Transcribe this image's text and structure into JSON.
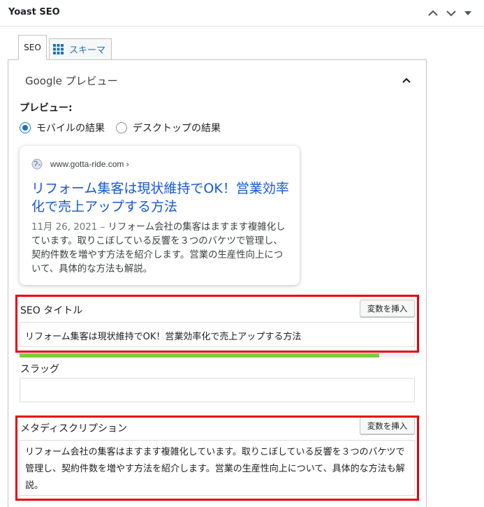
{
  "header": {
    "title": "Yoast SEO"
  },
  "tabs": [
    {
      "label": "SEO"
    },
    {
      "label": "スキーマ"
    }
  ],
  "google_preview": {
    "title": "Google プレビュー",
    "preview_label": "プレビュー:",
    "radio_mobile": "モバイルの結果",
    "radio_desktop": "デスクトップの結果",
    "selected_mode": "モバイルの結果"
  },
  "serp_card": {
    "url": "www.gotta-ride.com",
    "url_suffix": " ›",
    "title": "リフォーム集客は現状維持でOK！営業効率化で売上アップする方法",
    "date": "11月 26, 2021",
    "separator": " – ",
    "description": "リフォーム会社の集客はますます複雑化しています。取りこぼしている反響を３つのバケツで管理し、契約件数を増やす方法を紹介します。営業の生産性向上について、具体的な方法も解説。"
  },
  "seo_title": {
    "label": "SEO タイトル",
    "insert_button": "変数を挿入",
    "value": "リフォーム集客は現状維持でOK！営業効率化で売上アップする方法",
    "progress": 0.91
  },
  "slug": {
    "label": "スラッグ",
    "value": ""
  },
  "meta_description": {
    "label": "メタディスクリプション",
    "insert_button": "変数を挿入",
    "value": "リフォーム会社の集客はますます複雑化しています。取りこぼしている反響を３つのバケツで管理し、契約件数を増やす方法を紹介します。営業の生産性向上について、具体的な方法も解説。"
  },
  "colors": {
    "link": "#1558d6",
    "highlight_border": "#e8000b",
    "progress_good": "#7ad03a",
    "tab_link": "#2271b1"
  }
}
